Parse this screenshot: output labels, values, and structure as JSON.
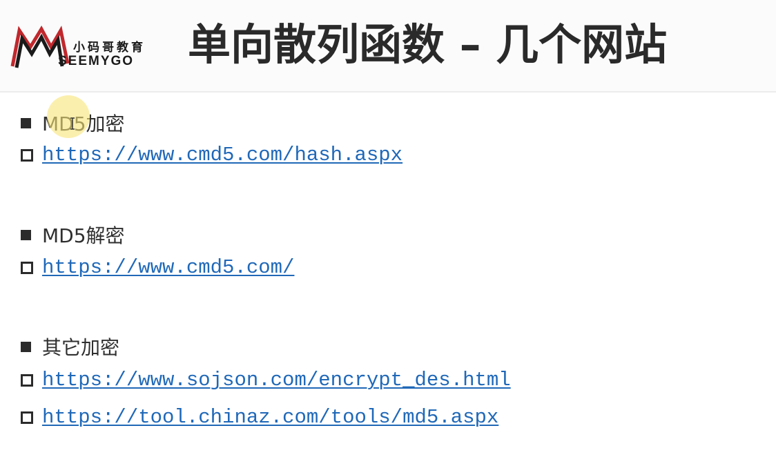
{
  "header": {
    "logo": {
      "cn_text": "小码哥教育",
      "en_text": "SEEMYGO"
    },
    "title": "单向散列函数 – 几个网站"
  },
  "sections": [
    {
      "heading": "MD5加密",
      "links": [
        "https://www.cmd5.com/hash.aspx"
      ]
    },
    {
      "heading": "MD5解密",
      "links": [
        "https://www.cmd5.com/"
      ]
    },
    {
      "heading": "其它加密",
      "links": [
        "https://www.sojson.com/encrypt_des.html",
        "https://tool.chinaz.com/tools/md5.aspx"
      ]
    }
  ],
  "colors": {
    "link": "#1f68b8",
    "title": "#2a2a2a",
    "logo_accent": "#c0282d"
  }
}
